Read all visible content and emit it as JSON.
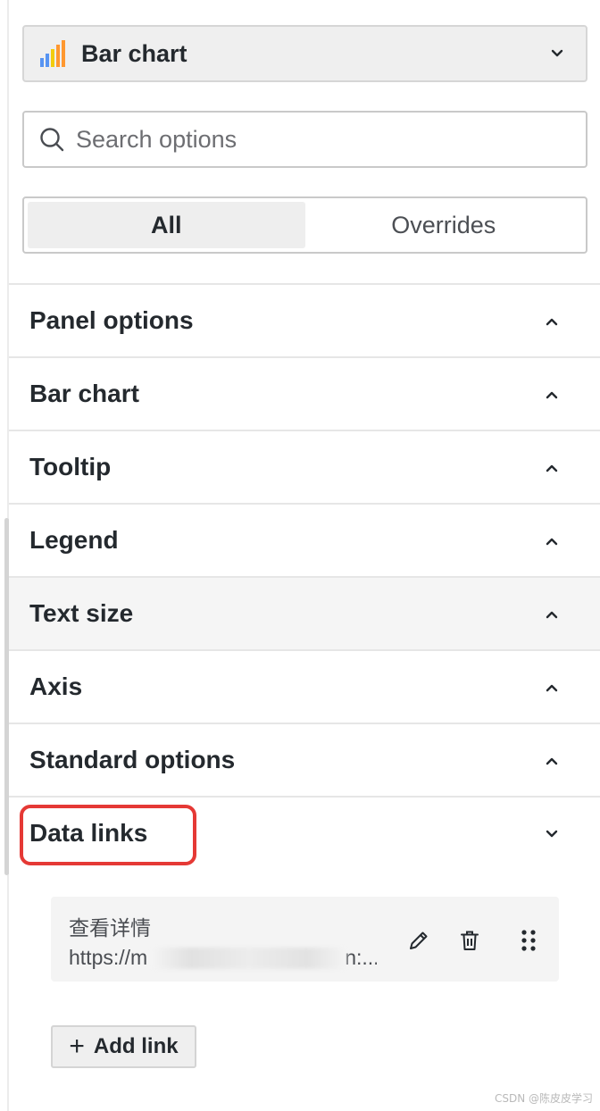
{
  "visualization_picker": {
    "label": "Bar chart",
    "icon": "bar-chart-icon"
  },
  "search": {
    "placeholder": "Search options",
    "value": ""
  },
  "tabs": [
    {
      "label": "All",
      "active": true
    },
    {
      "label": "Overrides",
      "active": false
    }
  ],
  "sections": [
    {
      "title": "Panel options",
      "expanded": false
    },
    {
      "title": "Bar chart",
      "expanded": false
    },
    {
      "title": "Tooltip",
      "expanded": false
    },
    {
      "title": "Legend",
      "expanded": false
    },
    {
      "title": "Text size",
      "expanded": false
    },
    {
      "title": "Axis",
      "expanded": false
    },
    {
      "title": "Standard options",
      "expanded": false
    },
    {
      "title": "Data links",
      "expanded": true
    }
  ],
  "data_links": {
    "items": [
      {
        "title": "查看详情",
        "url": "https://m",
        "url_tail": "n:..."
      }
    ],
    "add_label": "Add link"
  },
  "watermark": "CSDN @陈皮皮学习",
  "colors": {
    "highlight": "#e53935",
    "bar_icon": [
      "#5794f2",
      "#f2cc0c",
      "#ff9830"
    ]
  }
}
